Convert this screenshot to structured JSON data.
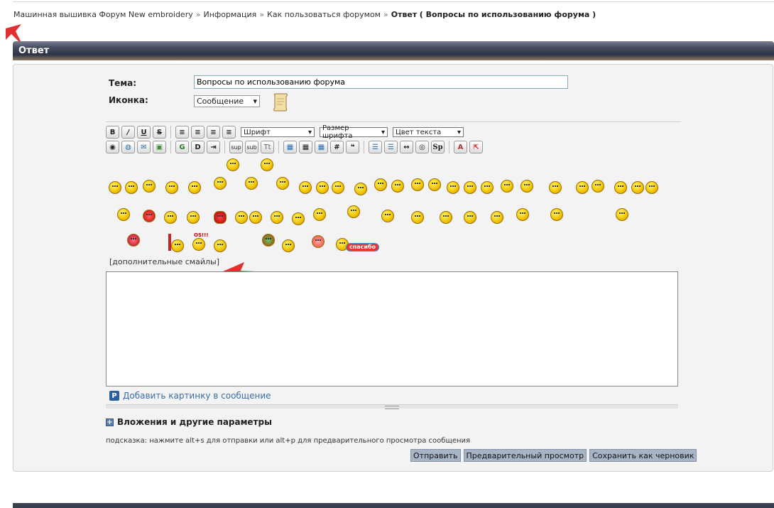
{
  "breadcrumbs": {
    "items": [
      "Машинная вышивка Форум New embroidery",
      "Информация",
      "Как пользоваться форумом"
    ],
    "separator": "»",
    "current": "Ответ",
    "current_detail": "( Вопросы по использованию форума )"
  },
  "header": {
    "title": "Ответ"
  },
  "form": {
    "subject_label": "Тема:",
    "subject_value": "Вопросы по использованию форума",
    "icon_label": "Иконка:",
    "icon_value": "Сообщение"
  },
  "toolbar": {
    "font_label": "Шрифт",
    "size_label": "Размер шрифта",
    "color_label": "Цвет текста",
    "sup_label": "sup",
    "sub_label": "sub",
    "tt_label": "Tt",
    "sp_label": "Sp"
  },
  "smileys": {
    "more_label": "[дополнительные смайлы]",
    "thanks_label": "спасибо",
    "os_label": "OS!!!"
  },
  "attachments": {
    "add_image_label": "Добавить картинку в сообщение",
    "section_label": "Вложения и другие параметры"
  },
  "hint": "подсказка: нажмите alt+s для отправки или alt+p для предварительного просмотра сообщения",
  "buttons": {
    "send": "Отправить",
    "preview": "Предварительный просмотр",
    "draft": "Сохранить как черновик"
  },
  "colors": {
    "accent_red": "#e03030",
    "header_dark": "#2d3346",
    "button_bg": "#a7b4c6"
  }
}
